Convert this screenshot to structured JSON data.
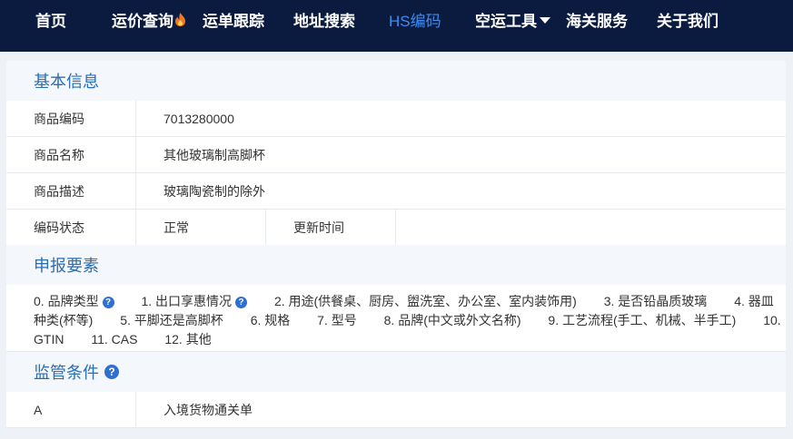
{
  "nav": {
    "items": [
      {
        "label": "首页"
      },
      {
        "label": "运价查询"
      },
      {
        "label": "运单跟踪"
      },
      {
        "label": "地址搜索"
      },
      {
        "label": "HS编码"
      },
      {
        "label": "空运工具"
      },
      {
        "label": "海关服务"
      },
      {
        "label": "关于我们"
      }
    ],
    "active_color": "#3d8ef0",
    "bg_color": "#0b1a3f"
  },
  "basic": {
    "title": "基本信息",
    "code_label": "商品编码",
    "code_value": "7013280000",
    "name_label": "商品名称",
    "name_value": "其他玻璃制高脚杯",
    "desc_label": "商品描述",
    "desc_value": "玻璃陶瓷制的除外",
    "status_label": "编码状态",
    "status_value": "正常",
    "update_label": "更新时间",
    "update_value": ""
  },
  "declaration": {
    "title": "申报要素",
    "items": [
      "0. 品牌类型",
      "1. 出口享惠情况",
      "2. 用途(供餐桌、厨房、盥洗室、办公室、室内装饰用)",
      "3. 是否铅晶质玻璃",
      "4. 器皿种类(杯等)",
      "5. 平脚还是高脚杯",
      "6. 规格",
      "7. 型号",
      "8. 品牌(中文或外文名称)",
      "9. 工艺流程(手工、机械、半手工)",
      "10. GTIN",
      "11. CAS",
      "12. 其他"
    ]
  },
  "supervision": {
    "title": "监管条件",
    "code": "A",
    "desc": "入境货物通关单"
  },
  "icons": {
    "help": "question-circle-icon",
    "flame": "flame-icon",
    "dropdown": "caret-down-icon"
  }
}
